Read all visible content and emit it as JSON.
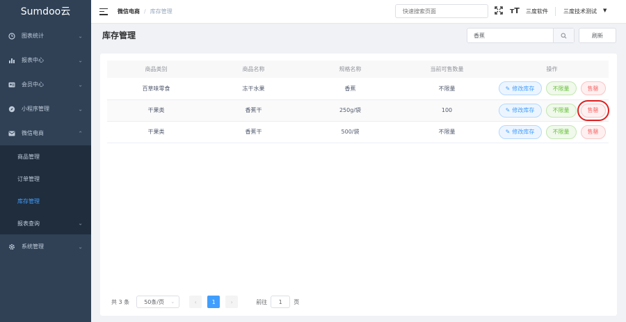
{
  "app": {
    "logo": "Sumdoo云"
  },
  "sidebar": {
    "items": [
      {
        "label": "图表统计",
        "icon": "clock-icon"
      },
      {
        "label": "报表中心",
        "icon": "bar-chart-icon"
      },
      {
        "label": "会员中心",
        "icon": "member-icon"
      },
      {
        "label": "小程序管理",
        "icon": "compass-icon"
      },
      {
        "label": "微信电商",
        "icon": "mail-icon"
      },
      {
        "label": "系统管理",
        "icon": "gear-icon"
      }
    ],
    "submenu": [
      {
        "label": "商品管理"
      },
      {
        "label": "订单管理"
      },
      {
        "label": "库存管理",
        "active": true
      },
      {
        "label": "报表查询"
      }
    ]
  },
  "header": {
    "breadcrumb": [
      "微信电商",
      "库存管理"
    ],
    "breadcrumb_sep": "/",
    "quick_search_placeholder": "快速搜索页面",
    "font_size_glyph": "тT",
    "company": "三度软件",
    "user": "三度技术测试"
  },
  "page": {
    "title": "库存管理",
    "search_value": "香蕉",
    "refresh_label": "刷新"
  },
  "table": {
    "columns": [
      "商品类别",
      "商品名称",
      "规格名称",
      "当前可售数量",
      "操作"
    ],
    "rows": [
      {
        "category": "百草味零食",
        "name": "冻干水果",
        "spec": "香蕉",
        "qty": "不限量"
      },
      {
        "category": "干果类",
        "name": "香蕉干",
        "spec": "250g/袋",
        "qty": "100"
      },
      {
        "category": "干果类",
        "name": "香蕉干",
        "spec": "500/袋",
        "qty": "不限量"
      }
    ],
    "actions": {
      "edit": "修改库存",
      "unlimited": "不限量",
      "soldout": "售罄"
    }
  },
  "pagination": {
    "total": "共 3 条",
    "page_size": "50条/页",
    "current_page": "1",
    "goto_label": "前往",
    "goto_value": "1",
    "page_suffix": "页"
  },
  "colors": {
    "sidebar_bg": "#304156",
    "accent": "#409eff",
    "highlight": "#e02020"
  }
}
